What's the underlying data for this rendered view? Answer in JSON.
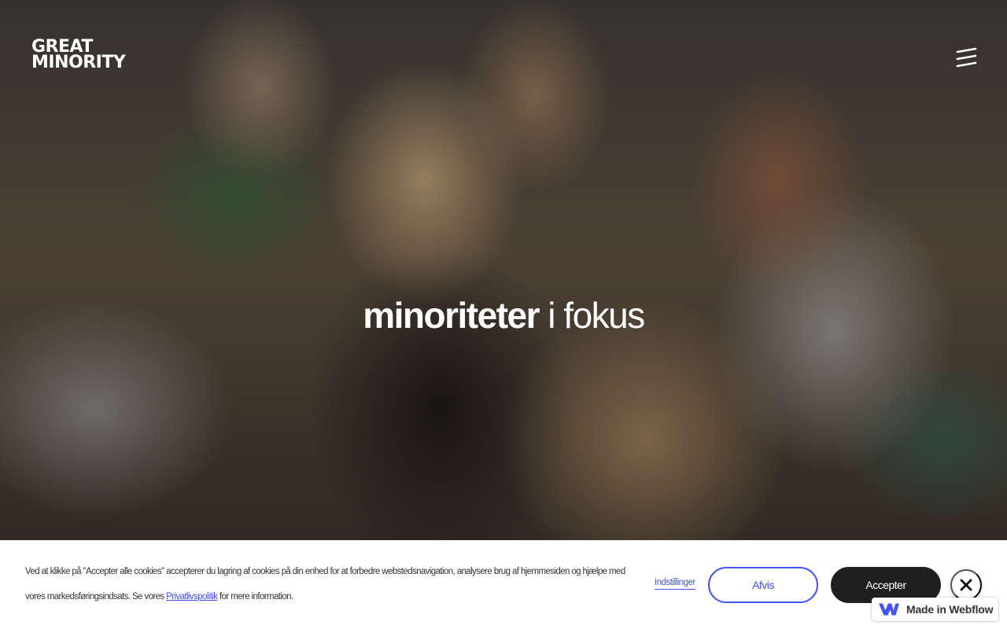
{
  "brand": {
    "logo_line1": "GREAT",
    "logo_line2": "MINORITY"
  },
  "header": {
    "menu_icon": "hamburger-menu-icon"
  },
  "hero": {
    "headline_bold": "minoriteter",
    "headline_light": "i fokus"
  },
  "cookie_banner": {
    "text_before_link": "Ved at klikke på \"Accepter alle cookies\" accepterer du lagring af cookies på din enhed for at forbedre webstedsnavigation, analysere brug af hjemmesiden og hjælpe med vores markedsføringsindsats. Se vores",
    "policy_link": "Privatlivspolitik",
    "text_after_link": "for mere information.",
    "settings_label": "Indstillinger",
    "reject_label": "Afvis",
    "accept_label": "Accepter",
    "close_icon": "close-icon"
  },
  "badge": {
    "label": "Made in Webflow",
    "icon": "webflow-logo-icon"
  },
  "colors": {
    "accent": "#4353ff",
    "accept_bg": "#1f1f1f",
    "banner_bg": "#ffffff"
  }
}
